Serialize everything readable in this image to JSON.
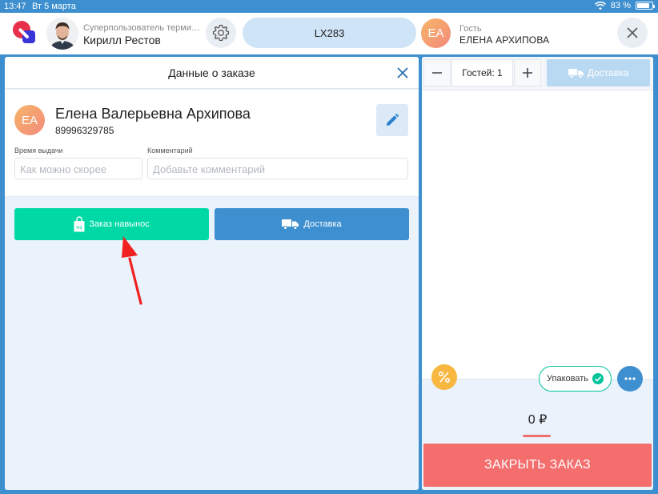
{
  "statusbar": {
    "time": "13:47",
    "date": "Вт 5 марта",
    "battery": "83 %",
    "battery_level": 0.83
  },
  "header": {
    "user_role": "Суперпользователь терминала",
    "user_name": "Кирилл Рестов",
    "table": "LX283",
    "guest_initials": "EA",
    "guest_label": "Гость",
    "guest_name": "ЕЛЕНА АРХИПОВА"
  },
  "order_panel": {
    "title": "Данные о заказе",
    "client": {
      "initials": "EA",
      "name": "Елена Валерьевна Архипова",
      "phone": "89996329785"
    },
    "time_label": "Время выдачи",
    "time_placeholder": "Как можно скорее",
    "comment_label": "Комментарий",
    "comment_placeholder": "Добавьте комментарий",
    "takeaway_label": "Заказ навынос",
    "delivery_label": "Доставка"
  },
  "cart": {
    "guests": "Гостей: 1",
    "delivery_label": "Доставка",
    "pack_label": "Упаковать",
    "total": "0 ₽",
    "close_order": "ЗАКРЫТЬ ЗАКАЗ"
  },
  "colors": {
    "primary": "#3d8fcf",
    "takeaway": "#00d9a6",
    "close_order": "#f46e6e",
    "discount": "#f7b740",
    "annotation_arrow": "#f02020"
  }
}
